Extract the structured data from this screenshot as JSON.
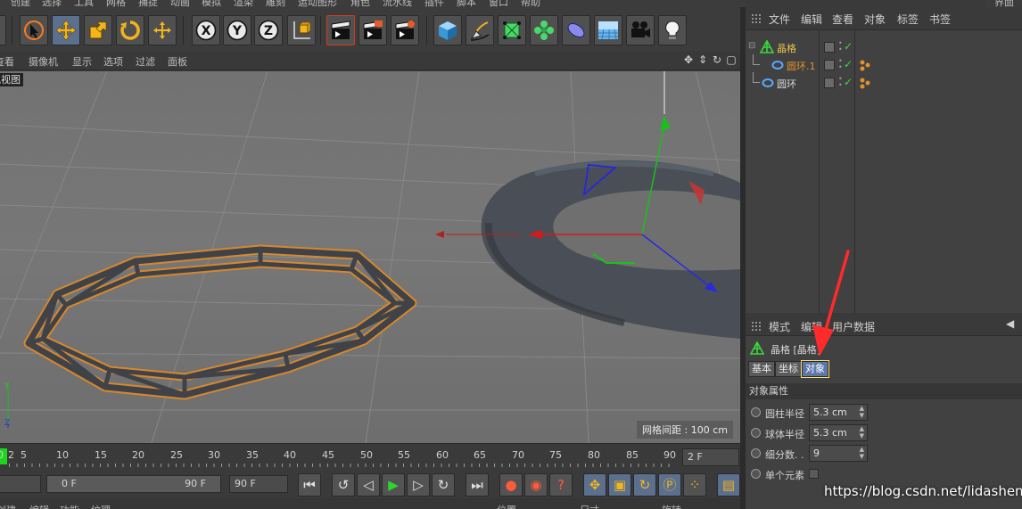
{
  "menubar": {
    "items": [
      "创建",
      "选择",
      "工具",
      "网格",
      "捕捉",
      "动画",
      "模拟",
      "渲染",
      "雕刻",
      "运动图形",
      "角色",
      "流水线",
      "插件",
      "脚本",
      "窗口",
      "帮助"
    ],
    "right_label": "界面"
  },
  "toolbar": {
    "icons": [
      "undo-icon",
      "select-cursor-icon",
      "move-icon",
      "scale-icon",
      "rotate-icon",
      "move-axis-icon",
      "x-axis-icon",
      "y-axis-icon",
      "z-axis-icon",
      "coordinate-system-icon",
      "render-view-icon",
      "render-picture-icon",
      "render-settings-icon",
      "cube-icon",
      "pen-icon",
      "subdivision-icon",
      "cloner-icon",
      "deformer-icon",
      "floor-icon",
      "camera-icon",
      "light-icon"
    ]
  },
  "viewport_menu": {
    "items": [
      "查看",
      "摄像机",
      "显示",
      "选项",
      "过滤",
      "面板"
    ],
    "nav_icons": [
      "✥",
      "⇕",
      "↻",
      "▢"
    ]
  },
  "viewport": {
    "label": "透视视图",
    "grid_spacing": "网格间距 : 100 cm",
    "axis_y": "Y",
    "axis_z": "Z"
  },
  "timeline": {
    "ticks": [
      "0",
      "2",
      "5",
      "10",
      "15",
      "20",
      "25",
      "30",
      "35",
      "40",
      "45",
      "50",
      "55",
      "60",
      "65",
      "70",
      "75",
      "80",
      "85",
      "90"
    ],
    "current_frame": "2 F"
  },
  "transport": {
    "start_field": "0 F",
    "range_start": "0 F",
    "range_end": "90 F",
    "end_field": "90 F"
  },
  "bottom_strip": {
    "items": [
      "创建",
      "编辑",
      "功能",
      "纹理",
      "位置",
      "尺寸",
      "旋转"
    ]
  },
  "object_manager": {
    "menu": [
      "文件",
      "编辑",
      "查看",
      "对象",
      "标签",
      "书签"
    ],
    "objects": [
      {
        "name": "晶格",
        "color": "#e8c24a"
      },
      {
        "name": "圆环.1",
        "color": "#e0922e"
      },
      {
        "name": "圆环",
        "color": "#d8d8d8"
      }
    ]
  },
  "attributes": {
    "menu": [
      "模式",
      "编辑",
      "用户数据"
    ],
    "title": "晶格 [晶格]",
    "tabs": [
      "基本",
      "坐标",
      "对象"
    ],
    "active_tab": "对象",
    "section": "对象属性",
    "params": [
      {
        "label": "圆柱半径",
        "value": "5.3 cm",
        "control": "number"
      },
      {
        "label": "球体半径",
        "value": "5.3 cm",
        "control": "number"
      },
      {
        "label": "细分数. .",
        "value": "9",
        "control": "number"
      },
      {
        "label": "单个元素",
        "value": "",
        "control": "checkbox"
      }
    ]
  },
  "watermark": "https://blog.csdn.net/lidashent",
  "colors": {
    "accent": "#5b78a8",
    "selection_orange": "#e0922e",
    "annotation_red": "#ff2a2a"
  }
}
